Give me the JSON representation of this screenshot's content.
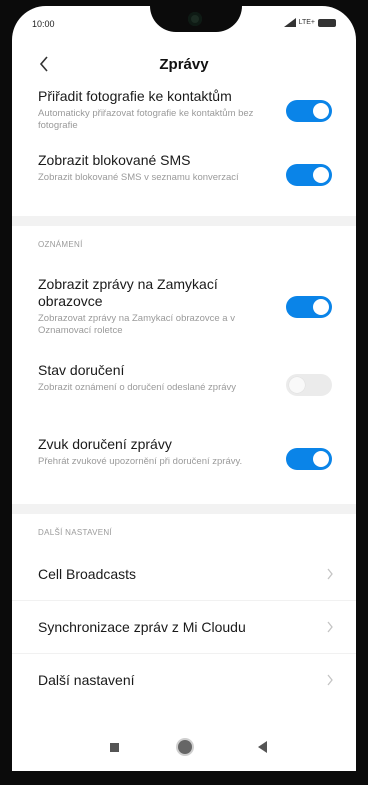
{
  "status_bar": {
    "time": "10:00",
    "network": "LTE+",
    "icons": [
      "signal-icon",
      "battery-icon"
    ]
  },
  "header": {
    "title": "Zprávy",
    "back_icon": "chevron-left-icon"
  },
  "settings_top": [
    {
      "title": "Přiřadit fotografie ke kontaktům",
      "subtitle": "Automaticky přiřazovat fotografie ke kontaktům bez fotografie",
      "enabled": true
    },
    {
      "title": "Zobrazit blokované SMS",
      "subtitle": "Zobrazit blokované SMS v seznamu konverzací",
      "enabled": true
    }
  ],
  "notifications": {
    "section_title": "OZNÁMENÍ",
    "items": [
      {
        "title": "Zobrazit zprávy na Zamykací obrazovce",
        "subtitle": "Zobrazovat zprávy na Zamykací obrazovce a v Oznamovací roletce",
        "enabled": true
      },
      {
        "title": "Stav doručení",
        "subtitle": "Zobrazit oznámení o doručení odeslané zprávy",
        "enabled": false
      },
      {
        "title": "Zvuk doručení zprávy",
        "subtitle": "Přehrát zvukové upozornění při doručení zprávy.",
        "enabled": true
      }
    ]
  },
  "more_settings": {
    "section_title": "DALŠÍ NASTAVENÍ",
    "items": [
      {
        "label": "Cell Broadcasts"
      },
      {
        "label": "Synchronizace zpráv z Mi Cloudu"
      },
      {
        "label": "Další nastavení"
      }
    ]
  },
  "colors": {
    "accent": "#0a84e8",
    "toggle_off": "#ebebeb",
    "section_bg": "#f2f2f2",
    "secondary_text": "#9a9a9a"
  },
  "navbar": {
    "icons": [
      "recents-icon",
      "home-icon",
      "back-icon"
    ]
  }
}
